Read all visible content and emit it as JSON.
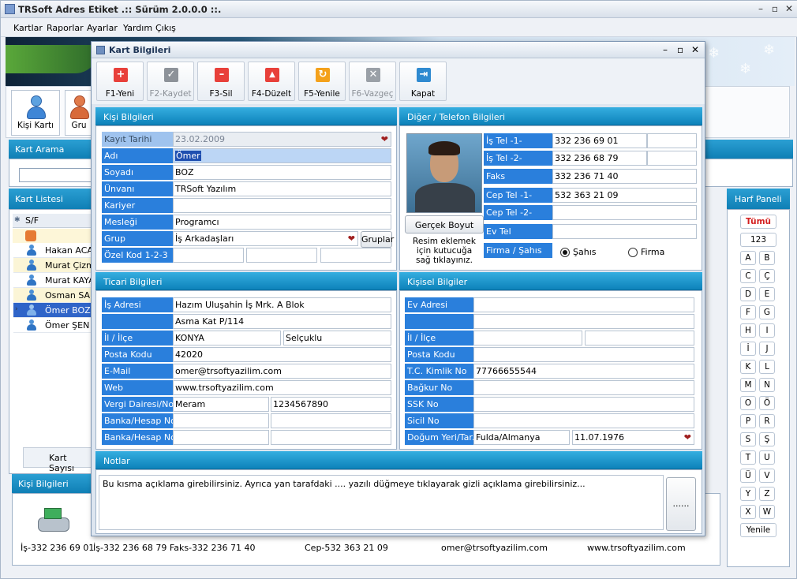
{
  "app": {
    "title": "TRSoft Adres Etiket  .:: Sürüm 2.0.0.0 ::."
  },
  "menu": [
    "Kartlar",
    "Raporlar",
    "Ayarlar",
    "Yardım",
    "Çıkış"
  ],
  "background": {
    "toolbar": [
      {
        "label": "Kişi Kartı"
      },
      {
        "label": "Gru"
      }
    ],
    "search_title": "Kart Arama",
    "list_title": "Kart Listesi",
    "list_header": "S/F",
    "list_rows": [
      "Hakan ACAR",
      "Murat Çizme",
      "Murat KAYA",
      "Osman SAR",
      "Ömer BOZ",
      "Ömer ŞEN"
    ],
    "count_label": "Kart Sayısı",
    "harf_title": "Harf Paneli",
    "harf_top": [
      "Tümü",
      "123"
    ],
    "letters": [
      "A",
      "B",
      "C",
      "Ç",
      "D",
      "E",
      "F",
      "G",
      "H",
      "I",
      "İ",
      "J",
      "K",
      "L",
      "M",
      "N",
      "O",
      "Ö",
      "P",
      "R",
      "S",
      "Ş",
      "T",
      "U",
      "Ü",
      "V",
      "Y",
      "Z",
      "X",
      "W"
    ],
    "refresh_label": "Yenile",
    "kisi_title": "Kişi Bilgileri",
    "footer": {
      "is": "İş-332 236 69 01",
      "is2": "İş-332 236 68 79 Faks-332 236 71 40",
      "cep": "Cep-532 363 21 09",
      "email": "omer@trsoftyazilim.com",
      "web": "www.trsoftyazilim.com"
    }
  },
  "dialog": {
    "title": "Kart Bilgileri",
    "toolbar": [
      {
        "label": "F1-Yeni",
        "icon": "plus-icon",
        "color": "#e8403a",
        "enabled": true
      },
      {
        "label": "F2-Kaydet",
        "icon": "check-icon",
        "color": "#8d9299",
        "enabled": false
      },
      {
        "label": "F3-Sil",
        "icon": "minus-icon",
        "color": "#e8403a",
        "enabled": true
      },
      {
        "label": "F4-Düzelt",
        "icon": "up-arrow-icon",
        "color": "#e8403a",
        "enabled": true
      },
      {
        "label": "F5-Yenile",
        "icon": "refresh-icon",
        "color": "#f4a11b",
        "enabled": true
      },
      {
        "label": "F6-Vazgeç",
        "icon": "x-icon",
        "color": "#9aa0a7",
        "enabled": false
      },
      {
        "label": "Kapat",
        "icon": "exit-door-icon",
        "color": "#2f8ad0",
        "enabled": true
      }
    ],
    "kisi": {
      "title": "Kişi Bilgileri",
      "kayit_tarihi": {
        "label": "Kayıt Tarihi",
        "value": "23.02.2009"
      },
      "adi": {
        "label": "Adı",
        "value": "Ömer"
      },
      "soyadi": {
        "label": "Soyadı",
        "value": "BOZ"
      },
      "unvani": {
        "label": "Ünvanı",
        "value": "TRSoft Yazılım"
      },
      "kariyer": {
        "label": "Kariyer",
        "value": ""
      },
      "meslegi": {
        "label": "Mesleği",
        "value": "Programcı"
      },
      "grup": {
        "label": "Grup",
        "value": "İş Arkadaşları",
        "button": "Gruplar"
      },
      "ozel_kod": {
        "label": "Özel Kod 1-2-3"
      }
    },
    "diger": {
      "title": "Diğer / Telefon Bilgileri",
      "is_tel1": {
        "label": "İş Tel -1-",
        "value": "332 236 69 01"
      },
      "is_tel2": {
        "label": "İş Tel -2-",
        "value": "332 236 68 79"
      },
      "faks": {
        "label": "Faks",
        "value": "332 236 71 40"
      },
      "cep_tel1": {
        "label": "Cep Tel -1-",
        "value": "532 363 21 09"
      },
      "cep_tel2": {
        "label": "Cep Tel -2-",
        "value": ""
      },
      "ev_tel": {
        "label": "Ev Tel",
        "value": ""
      },
      "firma_sahis": {
        "label": "Firma / Şahıs",
        "options": [
          "Şahıs",
          "Firma"
        ],
        "selected": "Şahıs"
      },
      "photo_button": "Gerçek Boyut",
      "photo_hint_1": "Resim eklemek",
      "photo_hint_2": "için kutucuğa",
      "photo_hint_3": "sağ tıklayınız."
    },
    "ticari": {
      "title": "Ticari Bilgileri",
      "is_adresi": {
        "label": "İş Adresi",
        "line1": "Hazım Uluşahin İş Mrk. A Blok",
        "line2": "Asma Kat P/114"
      },
      "il_ilce": {
        "label": "İl / İlçe",
        "il": "KONYA",
        "ilce": "Selçuklu"
      },
      "posta_kodu": {
        "label": "Posta Kodu",
        "value": "42020"
      },
      "email": {
        "label": "E-Mail",
        "value": "omer@trsoftyazilim.com"
      },
      "web": {
        "label": "Web",
        "value": "www.trsoftyazilim.com"
      },
      "vergi": {
        "label": "Vergi Dairesi/No",
        "daire": "Meram",
        "no": "1234567890"
      },
      "banka1": {
        "label": "Banka/Hesap No"
      },
      "banka2": {
        "label": "Banka/Hesap No"
      }
    },
    "kisisel": {
      "title": "Kişisel Bilgiler",
      "ev_adresi": {
        "label": "Ev Adresi"
      },
      "il_ilce": {
        "label": "İl / İlçe"
      },
      "posta_kodu": {
        "label": "Posta Kodu"
      },
      "tc": {
        "label": "T.C. Kimlik No",
        "value": "77766655544"
      },
      "bagkur": {
        "label": "Bağkur No"
      },
      "ssk": {
        "label": "SSK No"
      },
      "sicil": {
        "label": "Sicil No"
      },
      "dogum": {
        "label": "Doğum Yeri/Tar.",
        "yer": "Fulda/Almanya",
        "tarih": "11.07.1976"
      }
    },
    "notlar": {
      "title": "Notlar",
      "text": "Bu kısma açıklama girebilirsiniz. Ayrıca yan tarafdaki .... yazılı düğmeye tıklayarak gizli açıklama girebilirsiniz...",
      "button": "......"
    }
  }
}
